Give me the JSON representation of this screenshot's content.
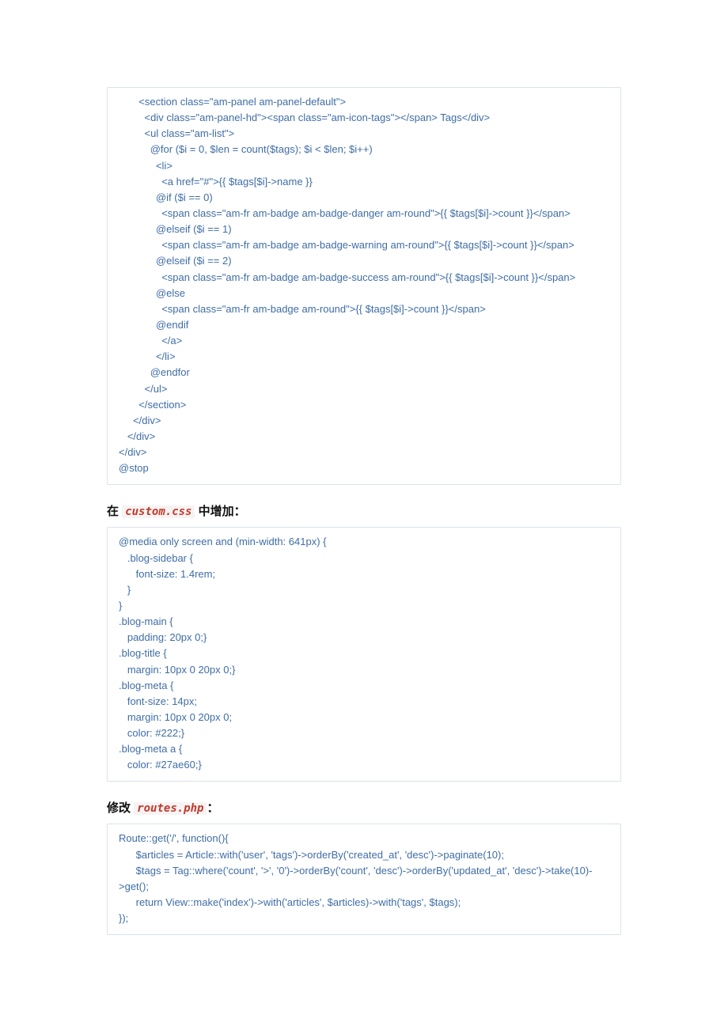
{
  "code1": "       <section class=\"am-panel am-panel-default\">\n         <div class=\"am-panel-hd\"><span class=\"am-icon-tags\"></span> Tags</div>\n         <ul class=\"am-list\">\n           @for ($i = 0, $len = count($tags); $i < $len; $i++)\n             <li>\n               <a href=\"#\">{{ $tags[$i]->name }}\n             @if ($i == 0)\n               <span class=\"am-fr am-badge am-badge-danger am-round\">{{ $tags[$i]->count }}</span>\n             @elseif ($i == 1)\n               <span class=\"am-fr am-badge am-badge-warning am-round\">{{ $tags[$i]->count }}</span>\n             @elseif ($i == 2)\n               <span class=\"am-fr am-badge am-badge-success am-round\">{{ $tags[$i]->count }}</span>\n             @else\n               <span class=\"am-fr am-badge am-round\">{{ $tags[$i]->count }}</span>\n             @endif\n               </a>\n             </li>\n           @endfor\n         </ul>\n       </section>\n     </div>\n   </div>\n</div>\n@stop",
  "heading1_pre": "在 ",
  "heading1_file": "custom.css",
  "heading1_post": " 中增加：",
  "code2": "@media only screen and (min-width: 641px) {\n   .blog-sidebar {\n      font-size: 1.4rem;\n   }\n}\n.blog-main {\n   padding: 20px 0;}\n.blog-title {\n   margin: 10px 0 20px 0;}\n.blog-meta {\n   font-size: 14px;\n   margin: 10px 0 20px 0;\n   color: #222;}\n.blog-meta a {\n   color: #27ae60;}",
  "heading2_pre": "修改 ",
  "heading2_file": "routes.php",
  "heading2_post": "：",
  "code3": "Route::get('/', function(){\n      $articles = Article::with('user', 'tags')->orderBy('created_at', 'desc')->paginate(10);\n      $tags = Tag::where('count', '>', '0')->orderBy('count', 'desc')->orderBy('updated_at', 'desc')->take(10)->get();\n      return View::make('index')->with('articles', $articles)->with('tags', $tags);\n});"
}
